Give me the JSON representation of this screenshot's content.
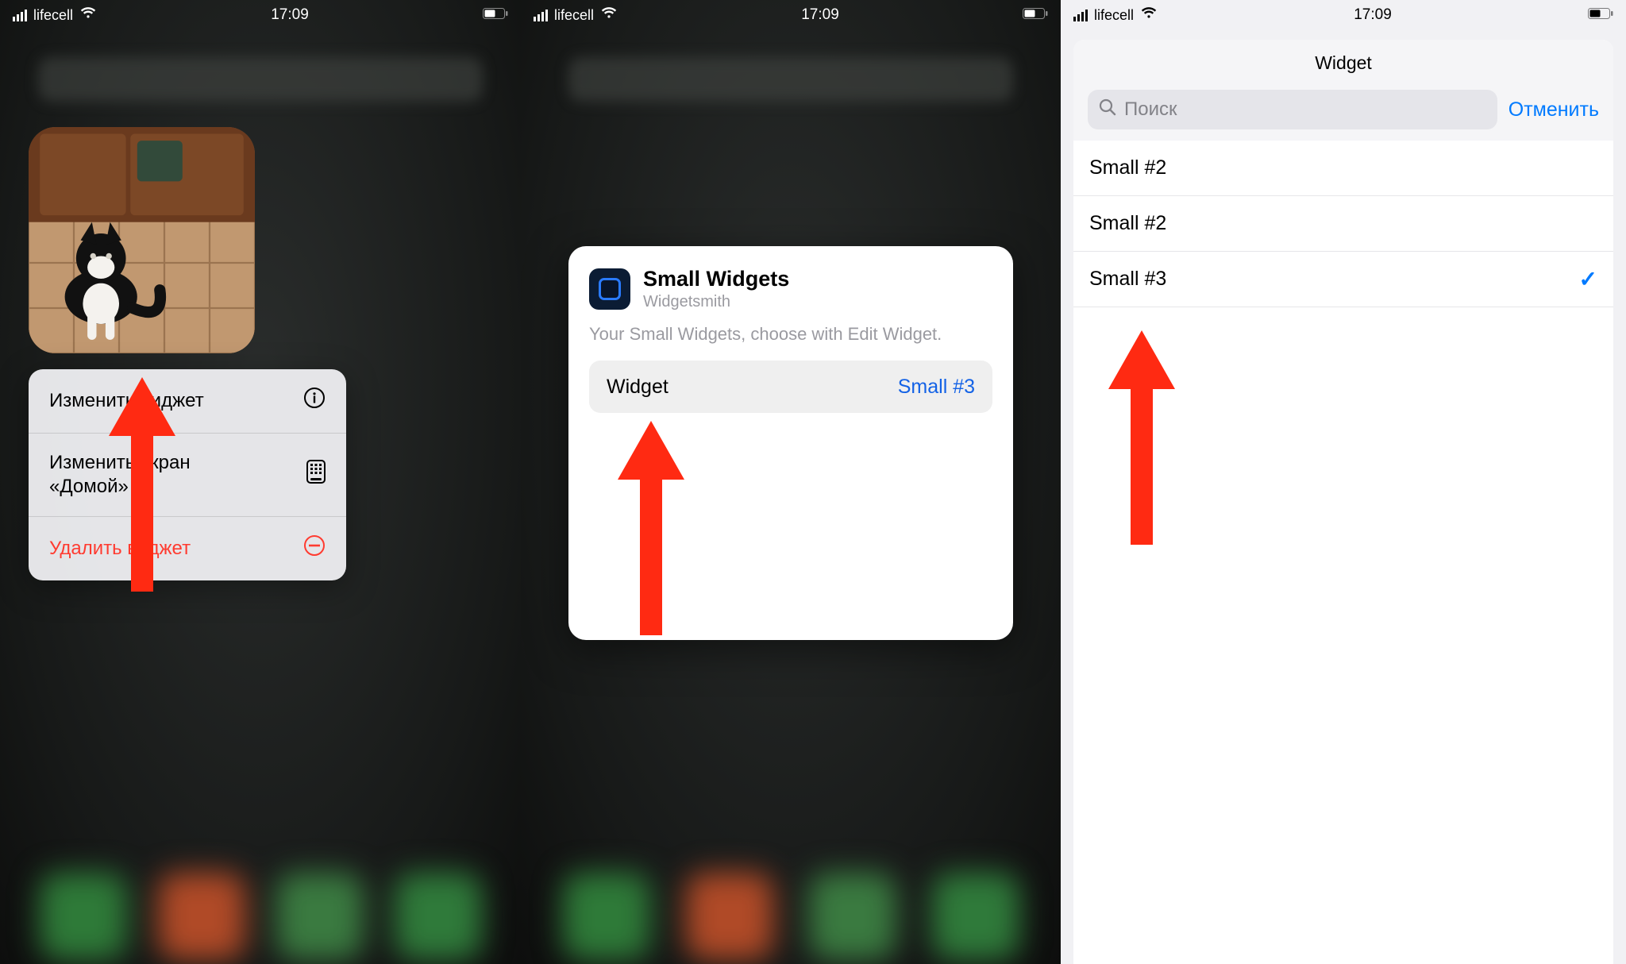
{
  "status": {
    "carrier": "lifecell",
    "time": "17:09"
  },
  "screen1": {
    "menu": {
      "edit_widget": "Изменить виджет",
      "edit_home_line1": "Изменить экран",
      "edit_home_line2": "«Домой»",
      "remove_widget": "Удалить виджет"
    }
  },
  "screen2": {
    "title": "Small Widgets",
    "subtitle": "Widgetsmith",
    "description": "Your Small Widgets, choose with Edit Widget.",
    "row": {
      "label": "Widget",
      "value": "Small #3"
    }
  },
  "screen3": {
    "sheet_title": "Widget",
    "search_placeholder": "Поиск",
    "cancel": "Отменить",
    "items": [
      {
        "label": "Small #2",
        "selected": false
      },
      {
        "label": "Small #2",
        "selected": false
      },
      {
        "label": "Small #3",
        "selected": true
      }
    ]
  },
  "colors": {
    "accent": "#007aff",
    "destructive": "#ff3b30",
    "arrow": "#ff2a12"
  }
}
